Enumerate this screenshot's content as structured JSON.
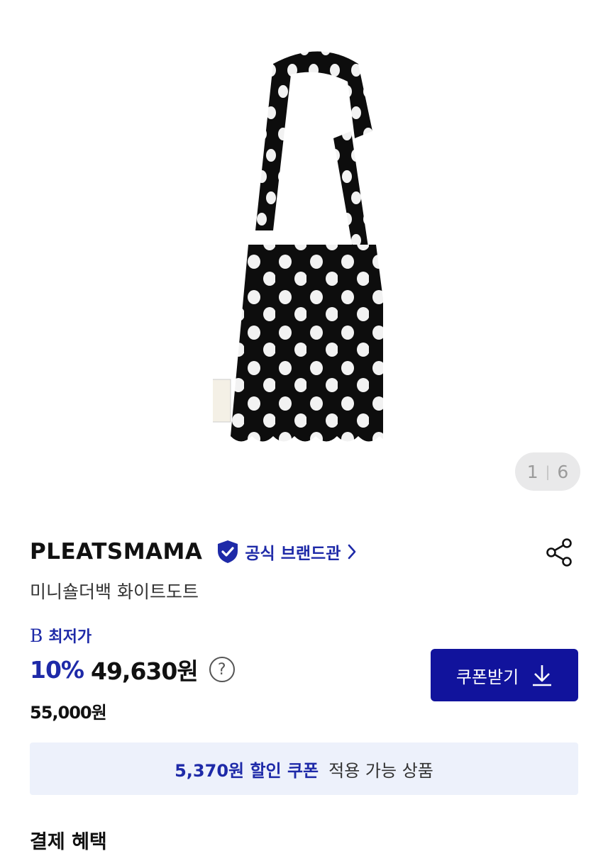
{
  "gallery": {
    "current": "1",
    "total": "6",
    "separator": "|"
  },
  "brand": {
    "name": "PLEATSMAMA",
    "official_label": "공식 브랜드관",
    "badge_icon": "shield-check-icon",
    "chevron_icon": "chevron-right-icon",
    "share_icon": "share-icon"
  },
  "product": {
    "name": "미니숄더백 화이트도트"
  },
  "pricing": {
    "lowest_badge": "B",
    "lowest_label": "최저가",
    "discount": "10%",
    "price": "49,630원",
    "help_icon": "question-icon",
    "help_symbol": "?",
    "original_price": "55,000원"
  },
  "coupon": {
    "button_label": "쿠폰받기",
    "download_icon": "download-arrow-icon",
    "banner_strong": "5,370원 할인 쿠폰",
    "banner_rest": "적용 가능 상품"
  },
  "sections": {
    "payment_benefits": "결제 혜택"
  },
  "colors": {
    "accent": "#1e2aa8",
    "button": "#11139c",
    "banner_bg": "#edf1fb"
  }
}
